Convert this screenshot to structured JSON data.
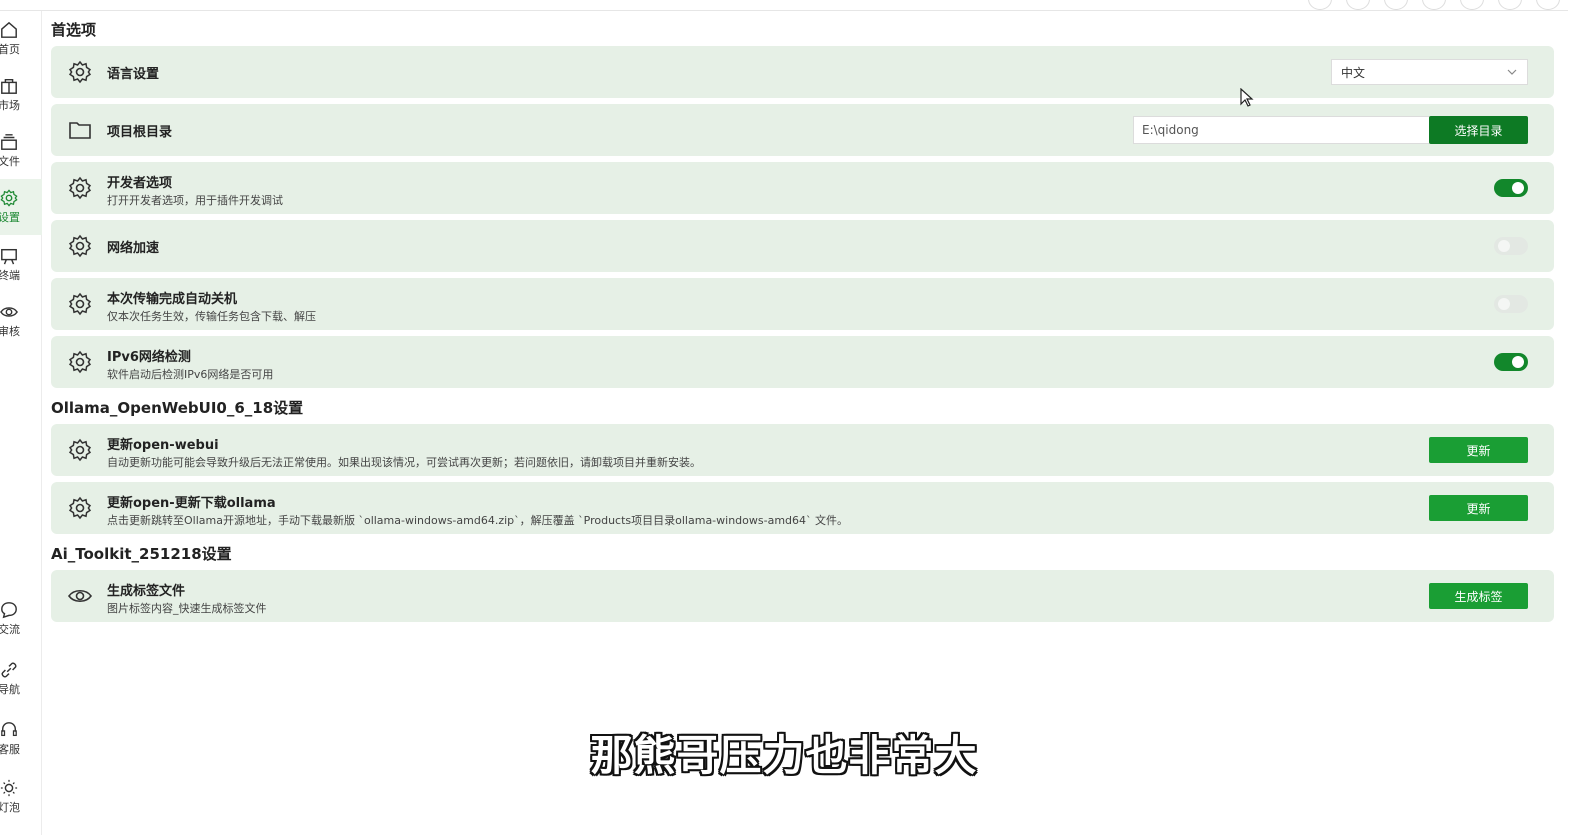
{
  "sidebar": {
    "items": [
      {
        "label": "首页",
        "icon": "home-icon"
      },
      {
        "label": "市场",
        "icon": "store-icon"
      },
      {
        "label": "文件",
        "icon": "files-icon"
      },
      {
        "label": "设置",
        "icon": "gear-icon",
        "active": true
      },
      {
        "label": "终端",
        "icon": "terminal-icon"
      },
      {
        "label": "审核",
        "icon": "eye-icon"
      },
      {
        "label": "交流",
        "icon": "chat-icon"
      },
      {
        "label": "导航",
        "icon": "link-icon"
      },
      {
        "label": "客服",
        "icon": "headset-icon"
      },
      {
        "label": "灯泡",
        "icon": "sun-icon"
      }
    ]
  },
  "sections": {
    "preferences_title": "首选项",
    "ollama_title": "Ollama_OpenWebUI0_6_18设置",
    "toolkit_title": "Ai_Toolkit_251218设置"
  },
  "rows": {
    "language": {
      "title": "语言设置",
      "value": "中文"
    },
    "root_dir": {
      "title": "项目根目录",
      "value": "E:\\qidong",
      "button": "选择目录"
    },
    "developer": {
      "title": "开发者选项",
      "desc": "打开开发者选项，用于插件开发调试",
      "enabled": true
    },
    "network": {
      "title": "网络加速",
      "enabled": false
    },
    "shutdown": {
      "title": "本次传输完成自动关机",
      "desc": "仅本次任务生效，传输任务包含下载、解压",
      "enabled": false
    },
    "ipv6": {
      "title": "IPv6网络检测",
      "desc": "软件启动后检测IPv6网络是否可用",
      "enabled": true
    },
    "update_webui": {
      "title": "更新open-webui",
      "desc": "自动更新功能可能会导致升级后无法正常使用。如果出现该情况，可尝试再次更新；若问题依旧，请卸载项目并重新安装。",
      "button": "更新"
    },
    "update_ollama": {
      "title": "更新open-更新下载ollama",
      "desc": "点击更新跳转至Ollama开源地址，手动下载最新版 `ollama-windows-amd64.zip`，解压覆盖 `Products项目目录ollama-windows-amd64` 文件。",
      "button": "更新"
    },
    "gen_tags": {
      "title": "生成标签文件",
      "desc": "图片标签内容_快速生成标签文件",
      "button": "生成标签"
    }
  },
  "subtitle": "那熊哥压力也非常大",
  "colors": {
    "accent": "#1a9e34",
    "row_bg": "#e6f0e6",
    "toggle_on": "#12872b"
  }
}
